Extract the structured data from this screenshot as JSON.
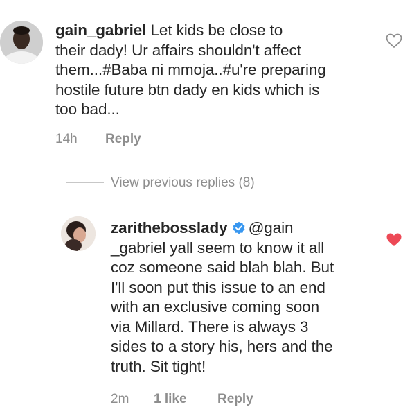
{
  "comments": [
    {
      "username": "gain_gabriel",
      "text_lines": [
        "Let kids be close to",
        "their dady! Ur affairs shouldn't affect",
        "them...#Baba ni mmoja..#u're preparing",
        "hostile future btn dady en kids which is",
        "too bad..."
      ],
      "time": "14h",
      "reply_label": "Reply",
      "heart_icon": "heart-outline-icon",
      "liked": false
    },
    {
      "username": "zarithebosslady",
      "verified": true,
      "verified_icon": "verified-badge-icon",
      "mention": "@gain",
      "text_lines": [
        "_gabriel yall seem to know it all",
        "coz someone said blah blah. But",
        "I'll soon put this issue to an end",
        "with an exclusive coming soon",
        "via Millard. There is always 3",
        "sides to a story his, hers and the",
        "truth. Sit tight!"
      ],
      "time": "2m",
      "likes": "1 like",
      "reply_label": "Reply",
      "heart_icon": "heart-filled-icon",
      "liked": true
    }
  ],
  "view_previous_replies": "View previous replies (8)",
  "colors": {
    "text": "#262626",
    "meta": "#8e8e8e",
    "heart_liked": "#ed4956",
    "verified_blue": "#3897f0"
  }
}
